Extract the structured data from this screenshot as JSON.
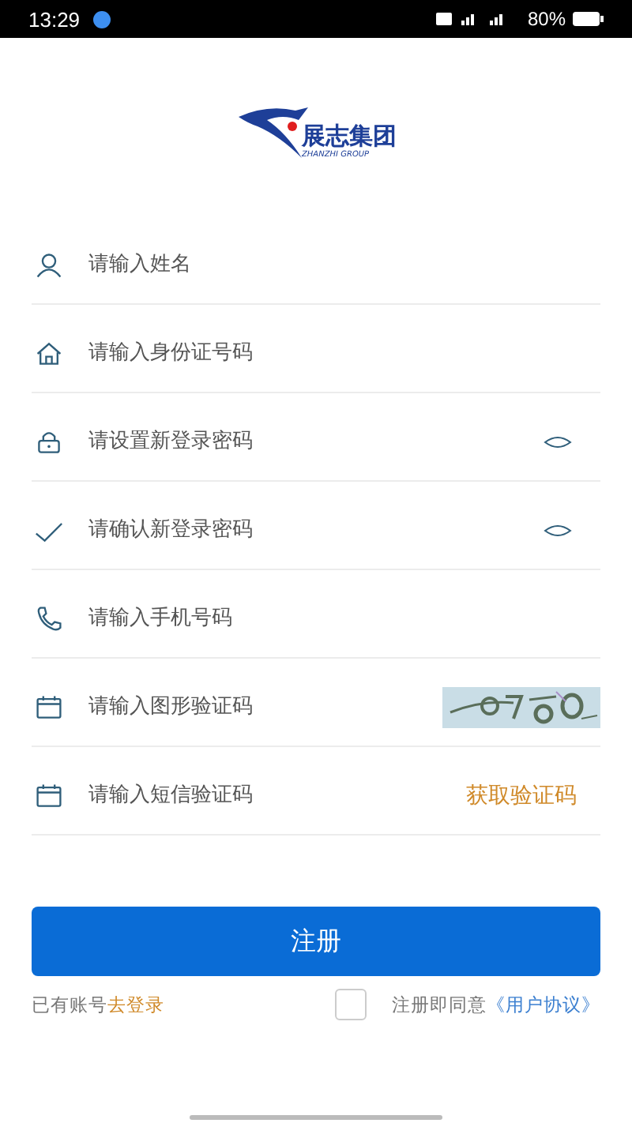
{
  "status_bar": {
    "time": "13:29",
    "battery": "80%"
  },
  "logo": {
    "name": "展志集团",
    "subtitle": "ZHANZHI GROUP"
  },
  "fields": [
    {
      "placeholder": "请输入姓名",
      "kind": "name"
    },
    {
      "placeholder": "请输入身份证号码",
      "kind": "idcard"
    },
    {
      "placeholder": "请设置新登录密码",
      "kind": "password"
    },
    {
      "placeholder": "请确认新登录密码",
      "kind": "confirm"
    },
    {
      "placeholder": "请输入手机号码",
      "kind": "phone"
    },
    {
      "placeholder": "请输入图形验证码",
      "kind": "captcha"
    },
    {
      "placeholder": "请输入短信验证码",
      "kind": "sms",
      "action": "获取验证码"
    }
  ],
  "register_button": "注册",
  "login_prompt": {
    "text": "已有账号",
    "link": "去登录"
  },
  "agreement": {
    "checked": false,
    "text": "注册即同意",
    "link": "《用户协议》"
  }
}
